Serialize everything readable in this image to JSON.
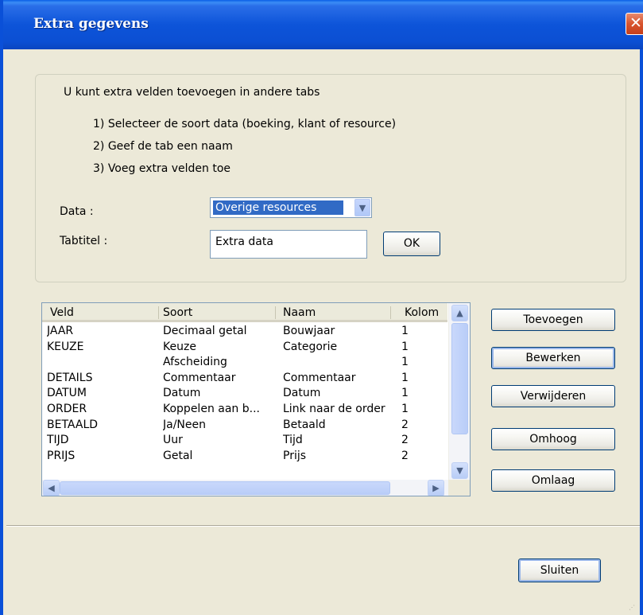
{
  "window": {
    "title": "Extra gegevens",
    "close_glyph": "✕"
  },
  "intro": {
    "heading": "U kunt extra velden toevoegen in andere tabs",
    "step1": "1) Selecteer de soort data (boeking, klant of resource)",
    "step2": "2) Geef de tab een naam",
    "step3": "3) Voeg extra velden toe"
  },
  "form": {
    "data_label": "Data :",
    "data_value": "Overige resources",
    "tabtitle_label": "Tabtitel :",
    "tabtitle_value": "Extra data",
    "ok_label": "OK"
  },
  "fields_table": {
    "columns": [
      "Veld",
      "Soort",
      "Naam",
      "Kolom"
    ],
    "rows": [
      [
        "JAAR",
        "Decimaal getal",
        "Bouwjaar",
        "1"
      ],
      [
        "KEUZE",
        "Keuze",
        "Categorie",
        "1"
      ],
      [
        "",
        "Afscheiding",
        "",
        "1"
      ],
      [
        "DETAILS",
        "Commentaar",
        "Commentaar",
        "1"
      ],
      [
        "DATUM",
        "Datum",
        "Datum",
        "1"
      ],
      [
        "ORDER",
        "Koppelen aan b...",
        "Link naar de order",
        "1"
      ],
      [
        "BETAALD",
        "Ja/Neen",
        "Betaald",
        "2"
      ],
      [
        "TIJD",
        "Uur",
        "Tijd",
        "2"
      ],
      [
        "PRIJS",
        "Getal",
        "Prijs",
        "2"
      ]
    ]
  },
  "actions": {
    "add": "Toevoegen",
    "edit": "Bewerken",
    "delete": "Verwijderen",
    "up": "Omhoog",
    "down": "Omlaag",
    "close": "Sluiten"
  },
  "icons": {
    "dropdown": "chevron-down-icon",
    "scroll_up": "arrow-up-icon",
    "scroll_down": "arrow-down-icon",
    "scroll_left": "arrow-left-icon",
    "scroll_right": "arrow-right-icon"
  },
  "colors": {
    "titlebar": "#0b4fd3",
    "selection": "#316ac5",
    "dialog_bg": "#ece9d8"
  }
}
